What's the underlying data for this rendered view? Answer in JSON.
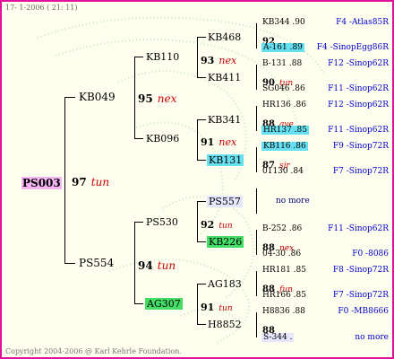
{
  "header": {
    "date": "17-  1-2006 ( 21: 11)"
  },
  "footer": {
    "copyright": "Copyright 2004-2006 @ Karl Kehrle Foundation."
  },
  "root": {
    "id": "PS003",
    "score": "97",
    "note": "tun"
  },
  "gen1": [
    {
      "id": "KB049",
      "score": "95",
      "note": "nex"
    },
    {
      "id": "PS554",
      "score": "94",
      "note": "tun"
    }
  ],
  "gen2": [
    {
      "id": "KB110",
      "score": "93",
      "note": "nex"
    },
    {
      "id": "KB096",
      "score": "91",
      "note": "nex"
    },
    {
      "id": "PS530",
      "score": "92",
      "note": "tun"
    },
    {
      "id": "AG307",
      "score": "91",
      "note": "tun"
    }
  ],
  "gen3": [
    {
      "id": "KB468"
    },
    {
      "id": "KB411"
    },
    {
      "id": "KB341"
    },
    {
      "id": "KB131"
    },
    {
      "id": "PS557"
    },
    {
      "id": "KB226"
    },
    {
      "id": "AG183"
    },
    {
      "id": "H8852"
    }
  ],
  "gen4": [
    {
      "line1": "KB344 .90",
      "line1_src": "F4 -Atlas85R",
      "score": "92",
      "note": "",
      "line3": "A-161 .89",
      "line3_src": "F4 -SinopEgg86R"
    },
    {
      "line1": "B-131 .88",
      "line1_src": "F12 -Sinop62R",
      "score": "90",
      "note": "tun",
      "line3": "SG046 .86",
      "line3_src": "F11 -Sinop62R"
    },
    {
      "line1": "HR136 .86",
      "line1_src": "F12 -Sinop62R",
      "score": "88",
      "note": "ave",
      "line3": "HR137 .85",
      "line3_src": "F11 -Sinop62R"
    },
    {
      "line1": "KB116 .86",
      "line1_src": "F9 -Sinop72R",
      "score": "87",
      "note": "sjr",
      "line3": "01130 .84",
      "line3_src": "F7 -Sinop72R"
    },
    {
      "no_more": "no more"
    },
    {
      "line1": "B-252 .86",
      "line1_src": "F11 -Sinop62R",
      "score": "88",
      "note": "nex",
      "line3": "04-30 .86",
      "line3_src": "F0 -8086"
    },
    {
      "line1": "HR181 .85",
      "line1_src": "F8 -Sinop72R",
      "score": "88",
      "note": "fun",
      "line3": "HR166 .85",
      "line3_src": "F7 -Sinop72R"
    },
    {
      "line1": "H8836 .88",
      "line1_src": "F0 -MB8666",
      "score": "88",
      "note": "",
      "line3": "S-344 .",
      "line3_src": "no more"
    }
  ]
}
